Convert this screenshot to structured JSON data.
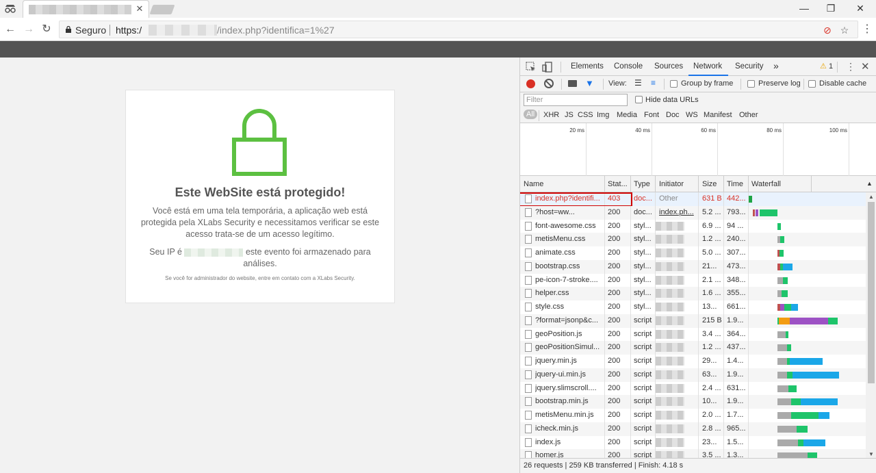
{
  "window": {
    "minimize": "—",
    "restore": "❐",
    "close": "✕"
  },
  "tab": {
    "close": "✕"
  },
  "toolbar": {
    "secure_label": "Seguro",
    "url_scheme": "https:/",
    "url_path": "/index.php?identifica=1%27"
  },
  "page": {
    "title": "Este WebSite está protegido!",
    "paragraph1": "Você está em uma tela temporária, a aplicação web está protegida pela XLabs Security e necessitamos verificar se este acesso trata-se de um acesso legítimo.",
    "ip_prefix": "Seu IP é",
    "ip_suffix": "este evento foi armazenado para análises.",
    "footer_note": "Se você for administrador do website, entre em contato com a XLabs Security.",
    "accent": "#5cc041"
  },
  "devtools": {
    "tabs": [
      "Elements",
      "Console",
      "Sources",
      "Network",
      "Security"
    ],
    "active_tab": "Network",
    "more": "»",
    "warnings": "1",
    "toolbar": {
      "view_label": "View:",
      "group_by_frame": "Group by frame",
      "preserve_log": "Preserve log",
      "disable_cache": "Disable cache"
    },
    "filter_placeholder": "Filter",
    "hide_data_urls": "Hide data URLs",
    "types": [
      "All",
      "XHR",
      "JS",
      "CSS",
      "Img",
      "Media",
      "Font",
      "Doc",
      "WS",
      "Manifest",
      "Other"
    ],
    "overview_ticks": [
      "20 ms",
      "40 ms",
      "60 ms",
      "80 ms",
      "100 ms"
    ],
    "columns": [
      "Name",
      "Stat...",
      "Type",
      "Initiator",
      "Size",
      "Time",
      "Waterfall"
    ],
    "rows": [
      {
        "name": "index.php?identifi...",
        "status": "403",
        "type": "doc...",
        "initiator": "Other",
        "size": "631 B",
        "time": "442...",
        "error": true
      },
      {
        "name": "?host=ww...",
        "status": "200",
        "type": "doc...",
        "initiator": "index.ph...",
        "size": "5.2 ...",
        "time": "793..."
      },
      {
        "name": "font-awesome.css",
        "status": "200",
        "type": "styl...",
        "initiator": "",
        "size": "6.9 ...",
        "time": "94 ..."
      },
      {
        "name": "metisMenu.css",
        "status": "200",
        "type": "styl...",
        "initiator": "",
        "size": "1.2 ...",
        "time": "240..."
      },
      {
        "name": "animate.css",
        "status": "200",
        "type": "styl...",
        "initiator": "",
        "size": "5.0 ...",
        "time": "307..."
      },
      {
        "name": "bootstrap.css",
        "status": "200",
        "type": "styl...",
        "initiator": "",
        "size": "21...",
        "time": "473..."
      },
      {
        "name": "pe-icon-7-stroke....",
        "status": "200",
        "type": "styl...",
        "initiator": "",
        "size": "2.1 ...",
        "time": "348..."
      },
      {
        "name": "helper.css",
        "status": "200",
        "type": "styl...",
        "initiator": "",
        "size": "1.6 ...",
        "time": "355..."
      },
      {
        "name": "style.css",
        "status": "200",
        "type": "styl...",
        "initiator": "",
        "size": "13...",
        "time": "661..."
      },
      {
        "name": "?format=jsonp&c...",
        "status": "200",
        "type": "script",
        "initiator": "",
        "size": "215 B",
        "time": "1.9..."
      },
      {
        "name": "geoPosition.js",
        "status": "200",
        "type": "script",
        "initiator": "",
        "size": "3.4 ...",
        "time": "364..."
      },
      {
        "name": "geoPositionSimul...",
        "status": "200",
        "type": "script",
        "initiator": "",
        "size": "1.2 ...",
        "time": "437..."
      },
      {
        "name": "jquery.min.js",
        "status": "200",
        "type": "script",
        "initiator": "",
        "size": "29...",
        "time": "1.4..."
      },
      {
        "name": "jquery-ui.min.js",
        "status": "200",
        "type": "script",
        "initiator": "",
        "size": "63...",
        "time": "1.9..."
      },
      {
        "name": "jquery.slimscroll....",
        "status": "200",
        "type": "script",
        "initiator": "",
        "size": "2.4 ...",
        "time": "631..."
      },
      {
        "name": "bootstrap.min.js",
        "status": "200",
        "type": "script",
        "initiator": "",
        "size": "10...",
        "time": "1.9..."
      },
      {
        "name": "metisMenu.min.js",
        "status": "200",
        "type": "script",
        "initiator": "",
        "size": "2.0 ...",
        "time": "1.7..."
      },
      {
        "name": "icheck.min.js",
        "status": "200",
        "type": "script",
        "initiator": "",
        "size": "2.8 ...",
        "time": "965..."
      },
      {
        "name": "index.js",
        "status": "200",
        "type": "script",
        "initiator": "",
        "size": "23...",
        "time": "1.5..."
      },
      {
        "name": "homer.js",
        "status": "200",
        "type": "script",
        "initiator": "",
        "size": "3.5 ...",
        "time": "1.3..."
      }
    ],
    "status_bar": "26 requests  |  259 KB transferred  |  Finish: 4.18 s"
  }
}
